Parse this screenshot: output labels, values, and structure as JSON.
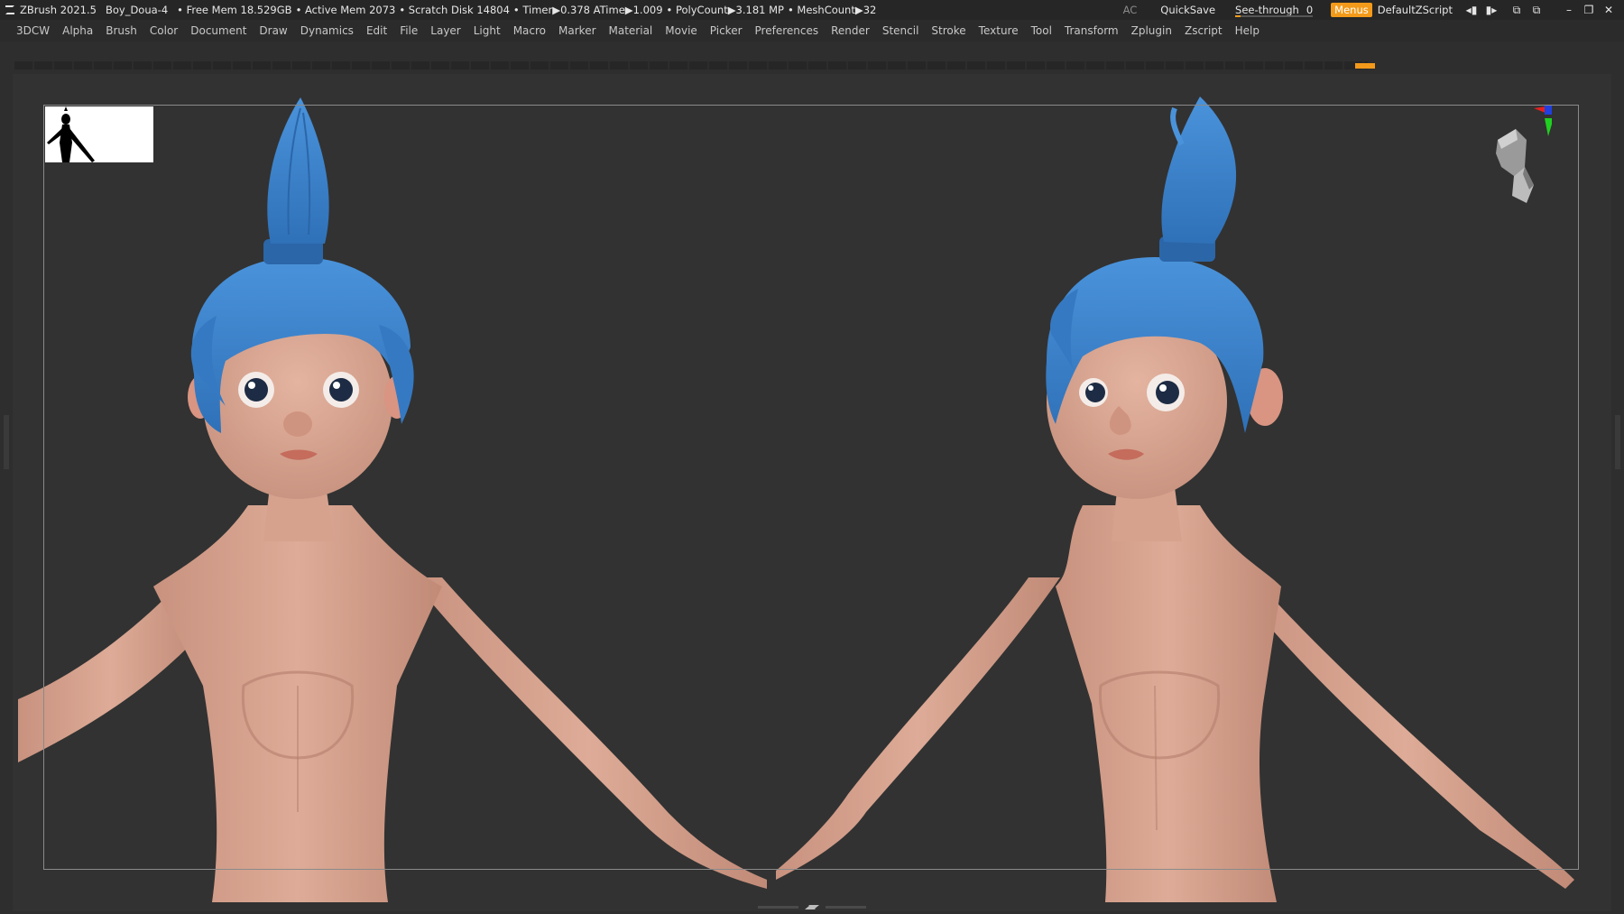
{
  "titlebar": {
    "app": "ZBrush 2021.5",
    "document": "Boy_Doua-4",
    "free_mem": "• Free Mem 18.529GB",
    "active_mem": "• Active Mem 2073",
    "scratch": "• Scratch Disk 14804",
    "timer": "• Timer▶0.378 ATime▶1.009",
    "polycount": "• PolyCount▶3.181 MP",
    "meshcount": "• MeshCount▶32",
    "ac": "AC",
    "quicksave": "QuickSave",
    "seethrough": "See-through",
    "seethrough_value": "0",
    "menus": "Menus",
    "script": "DefaultZScript",
    "accent_color": "#f39a1a"
  },
  "menubar": {
    "items": [
      "3DCW",
      "Alpha",
      "Brush",
      "Color",
      "Document",
      "Draw",
      "Dynamics",
      "Edit",
      "File",
      "Layer",
      "Light",
      "Macro",
      "Marker",
      "Material",
      "Movie",
      "Picker",
      "Preferences",
      "Render",
      "Stencil",
      "Stroke",
      "Texture",
      "Tool",
      "Transform",
      "Zplugin",
      "Zscript",
      "Help"
    ]
  },
  "viewport": {
    "background": "#323232",
    "skin_color": "#d8a48f",
    "hair_color": "#3d84cf",
    "eye_color": "#1d2c44"
  }
}
